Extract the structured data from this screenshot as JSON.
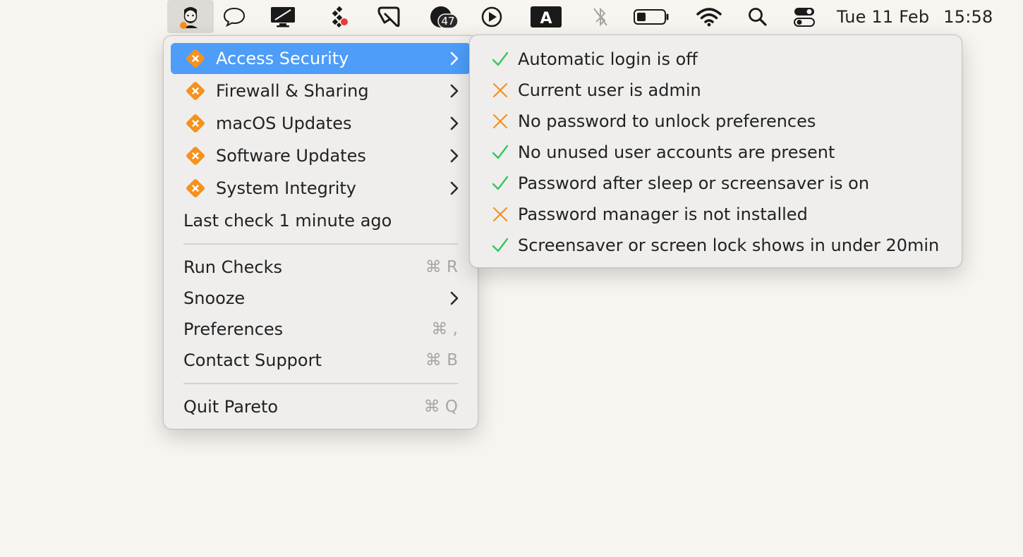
{
  "menubar": {
    "icons": [
      {
        "name": "pareto-app-icon"
      },
      {
        "name": "speech-bubble-icon"
      },
      {
        "name": "display-icon"
      },
      {
        "name": "diamond-grid-icon"
      },
      {
        "name": "clip-icon"
      },
      {
        "name": "notification-badge-icon",
        "badge": "47"
      },
      {
        "name": "play-circle-icon"
      },
      {
        "name": "input-source-icon",
        "letter": "A"
      },
      {
        "name": "bluetooth-off-icon"
      },
      {
        "name": "battery-icon"
      },
      {
        "name": "wifi-icon"
      },
      {
        "name": "spotlight-search-icon"
      },
      {
        "name": "control-center-icon"
      }
    ],
    "date": "Tue 11 Feb",
    "time": "15:58"
  },
  "colors": {
    "accent": "#4d9df9",
    "warning": "#f5921e",
    "ok": "#34c759",
    "menu_bg": "#efeeed",
    "desktop_bg": "#f8f4f0"
  },
  "main_menu": {
    "categories": [
      {
        "label": "Access Security",
        "status": "warning",
        "active": true
      },
      {
        "label": "Firewall & Sharing",
        "status": "warning"
      },
      {
        "label": "macOS Updates",
        "status": "warning"
      },
      {
        "label": "Software Updates",
        "status": "warning"
      },
      {
        "label": "System Integrity",
        "status": "warning"
      }
    ],
    "last_check": "Last check 1 minute ago",
    "actions": {
      "run_checks": {
        "label": "Run Checks",
        "shortcut": "⌘ R"
      },
      "snooze": {
        "label": "Snooze"
      },
      "preferences": {
        "label": "Preferences",
        "shortcut": "⌘ ,"
      },
      "contact_support": {
        "label": "Contact Support",
        "shortcut": "⌘ B"
      },
      "quit": {
        "label": "Quit Pareto",
        "shortcut": "⌘ Q"
      }
    }
  },
  "submenu": {
    "checks": [
      {
        "label": "Automatic login is off",
        "status": "pass"
      },
      {
        "label": "Current user is admin",
        "status": "fail"
      },
      {
        "label": "No password to unlock preferences",
        "status": "fail"
      },
      {
        "label": "No unused user accounts are present",
        "status": "pass"
      },
      {
        "label": "Password after sleep or screensaver is on",
        "status": "pass"
      },
      {
        "label": "Password manager is not installed",
        "status": "fail"
      },
      {
        "label": "Screensaver or screen lock shows in under 20min",
        "status": "pass"
      }
    ]
  }
}
